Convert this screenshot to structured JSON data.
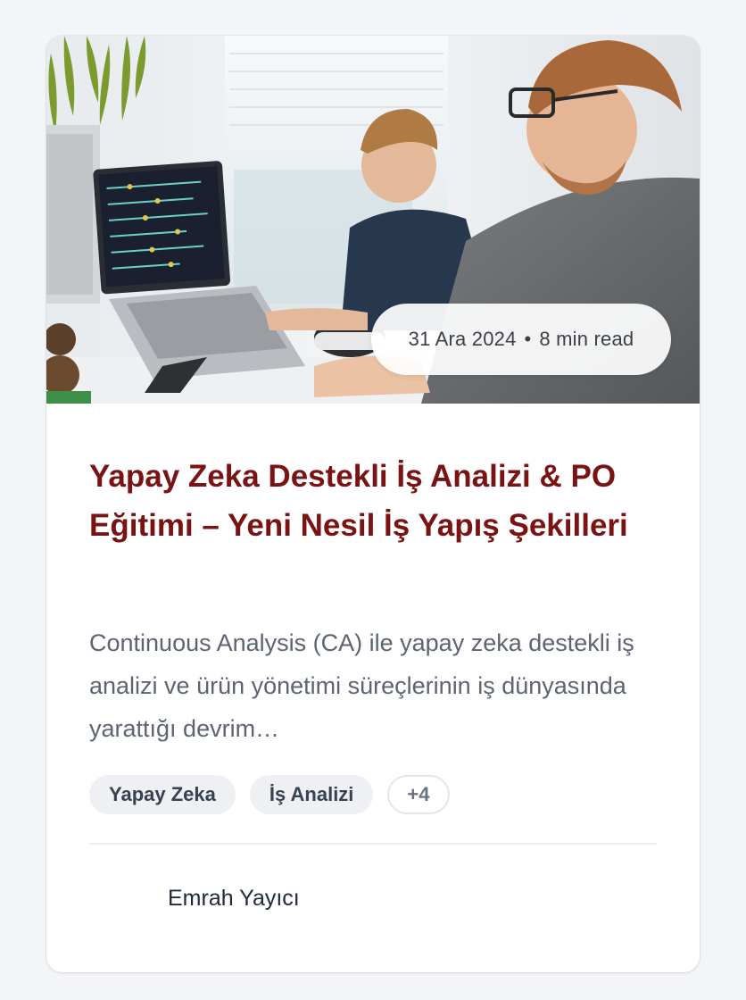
{
  "card": {
    "image_alt": "Two developers working at computers in an office",
    "date": "31 Ara 2024",
    "separator": "•",
    "read_time": "8 min read",
    "title": "Yapay Zeka Destekli İş Analizi & PO Eğitimi – Yeni Nesil İş Yapış Şekilleri",
    "excerpt": "Continuous Analysis (CA) ile yapay zeka destekli iş analizi ve ürün yönetimi süreçlerinin iş dünyasında yarattığı devrim…",
    "tags": [
      "Yapay Zeka",
      "İş Analizi"
    ],
    "more_tags": "+4",
    "author": "Emrah Yayıcı"
  },
  "colors": {
    "title": "#7a1414",
    "excerpt": "#5d6471",
    "tag_bg": "#eef0f4",
    "page_bg": "#f4f5f8"
  }
}
